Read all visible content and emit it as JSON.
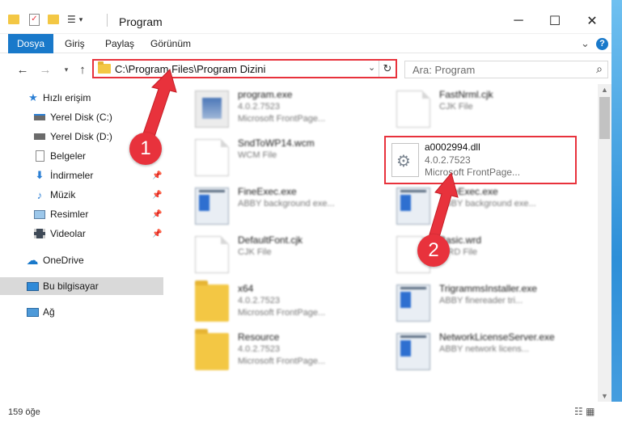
{
  "window": {
    "title": "Program",
    "minimize": "─",
    "maximize": "☐",
    "close": "✕"
  },
  "ribbon": {
    "tabs": [
      "Dosya",
      "Giriş",
      "Paylaş",
      "Görünüm"
    ],
    "help": "?",
    "expand": "⌄"
  },
  "address": {
    "path": "C:\\Program Files\\Program Dizini",
    "search_placeholder": "Ara: Program"
  },
  "sidebar": {
    "items": [
      {
        "label": "Hızlı erişim",
        "icon": "star-icon"
      },
      {
        "label": "Yerel Disk (C:)",
        "icon": "drive-icon"
      },
      {
        "label": "Yerel Disk (D:)",
        "icon": "drive-icon"
      },
      {
        "label": "Belgeler",
        "icon": "documents-icon"
      },
      {
        "label": "İndirmeler",
        "icon": "downloads-icon"
      },
      {
        "label": "Müzik",
        "icon": "music-icon"
      },
      {
        "label": "Resimler",
        "icon": "pictures-icon"
      },
      {
        "label": "Videolar",
        "icon": "videos-icon"
      },
      {
        "label": "OneDrive",
        "icon": "cloud-icon"
      },
      {
        "label": "Bu bilgisayar",
        "icon": "computer-icon"
      },
      {
        "label": "Ağ",
        "icon": "network-icon"
      }
    ]
  },
  "files": [
    {
      "name": "program.exe",
      "line2": "4.0.2.7523",
      "line3": "Microsoft FrontPage..."
    },
    {
      "name": "FastNrml.cjk",
      "line2": "CJK File",
      "line3": ""
    },
    {
      "name": "SndToWP14.wcm",
      "line2": "WCM File",
      "line3": ""
    },
    {
      "name": "FineExec.exe",
      "line2": "ABBY background exe...",
      "line3": ""
    },
    {
      "name": "FineExec.exe",
      "line2": "ABBY background exe...",
      "line3": ""
    },
    {
      "name": "DefaultFont.cjk",
      "line2": "CJK File",
      "line3": ""
    },
    {
      "name": "Basic.wrd",
      "line2": "WRD File",
      "line3": ""
    },
    {
      "name": "x64",
      "line2": "4.0.2.7523",
      "line3": "Microsoft FrontPage..."
    },
    {
      "name": "TrigrammsInstaller.exe",
      "line2": "ABBY finereader tri...",
      "line3": ""
    },
    {
      "name": "Resource",
      "line2": "4.0.2.7523",
      "line3": "Microsoft FrontPage..."
    },
    {
      "name": "NetworkLicenseServer.exe",
      "line2": "ABBY network licens...",
      "line3": ""
    }
  ],
  "highlighted_file": {
    "name": "a0002994.dll",
    "version": "4.0.2.7523",
    "description": "Microsoft FrontPage..."
  },
  "status": {
    "count": "159 öğe"
  },
  "annotations": {
    "step1": "1",
    "step2": "2",
    "color": "#e8323c"
  }
}
